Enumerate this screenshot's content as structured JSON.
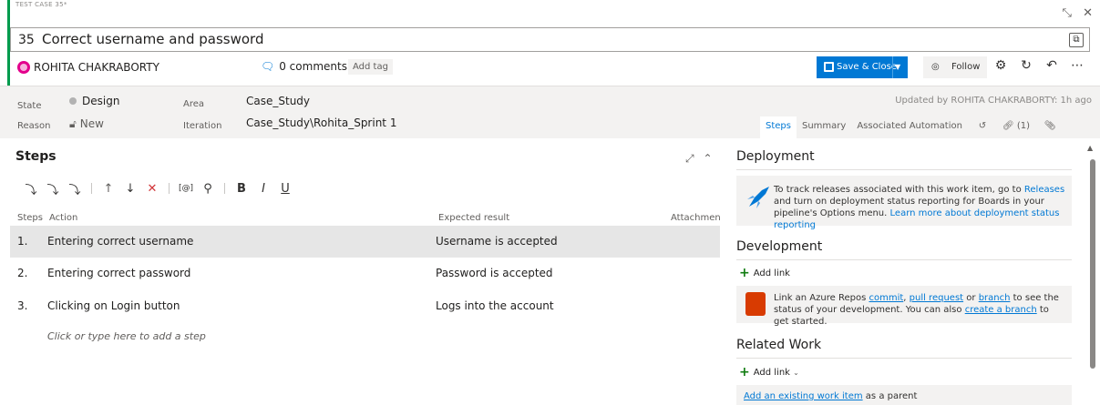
{
  "header": {
    "case_label": "TEST CASE 35*",
    "work_item_id": "35",
    "title": "Correct username and password",
    "assignee": "ROHITA CHAKRABORTY",
    "comments": "0 comments",
    "add_tag": "Add tag",
    "save_close": "Save & Close",
    "follow": "Follow"
  },
  "meta": {
    "state_label": "State",
    "state_value": "Design",
    "reason_label": "Reason",
    "reason_value": "New",
    "area_label": "Area",
    "area_value": "Case_Study",
    "iteration_label": "Iteration",
    "iteration_value": "Case_Study\\Rohita_Sprint 1",
    "updated_by": "Updated by ROHITA CHAKRABORTY: 1h ago"
  },
  "tabs": {
    "steps": "Steps",
    "summary": "Summary",
    "associated_automation": "Associated Automation",
    "links_count": "(1)"
  },
  "steps": {
    "title": "Steps",
    "columns": {
      "steps": "Steps",
      "action": "Action",
      "expected": "Expected result",
      "attachments": "Attachmen"
    },
    "rows": [
      {
        "num": "1.",
        "action": "Entering correct username",
        "expected": "Username is accepted"
      },
      {
        "num": "2.",
        "action": "Entering correct password",
        "expected": "Password is accepted"
      },
      {
        "num": "3.",
        "action": "Clicking on Login button",
        "expected": "Logs into the account"
      }
    ],
    "add_step": "Click or type here to add a step"
  },
  "deployment": {
    "title": "Deployment",
    "text1": "To track releases associated with this work item, go to",
    "releases_link": "Releases",
    "text2": "and turn on deployment status reporting for Boards in your pipeline's Options menu.",
    "learn_more": "Learn more about deployment status reporting"
  },
  "development": {
    "title": "Development",
    "add_link": "Add link",
    "text1": "Link an Azure Repos",
    "commit": "commit",
    "pull_request": "pull request",
    "or": "or",
    "branch": "branch",
    "text2": "to see the status of your development. You can also",
    "create_branch": "create a branch",
    "text3": "to get started."
  },
  "related_work": {
    "title": "Related Work",
    "add_link": "Add link",
    "existing": "Add an existing work item",
    "as_parent": "as a parent"
  },
  "colors": {
    "accent": "#0078d4",
    "type_bar": "#009b4d",
    "delete": "#d13438"
  }
}
